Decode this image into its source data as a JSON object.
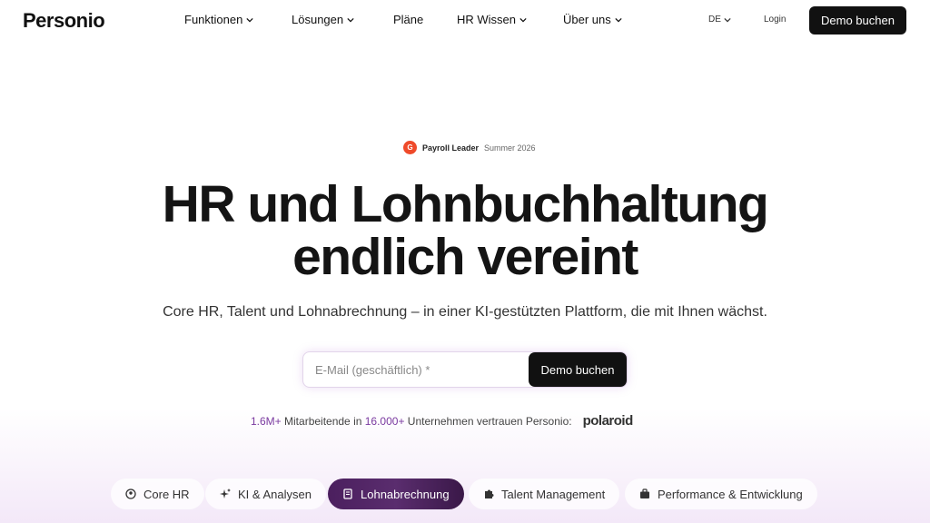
{
  "nav": {
    "logo": "Personio",
    "menu": [
      {
        "label": "Funktionen",
        "dropdown": true
      },
      {
        "label": "Lösungen",
        "dropdown": true
      },
      {
        "label": "Pläne",
        "dropdown": false
      },
      {
        "label": "HR Wissen",
        "dropdown": true
      },
      {
        "label": "Über uns",
        "dropdown": true
      }
    ],
    "lang": "DE",
    "login": "Login",
    "demo": "Demo buchen"
  },
  "badge": {
    "icon": "G",
    "title": "Payroll Leader",
    "subtitle": "Summer 2026"
  },
  "hero": {
    "title_line1": "HR und Lohnbuchhaltung",
    "title_line2": "endlich vereint",
    "subtitle": "Core HR, Talent und Lohnabrechnung – in einer KI-gestützten Plattform, die mit Ihnen wächst.",
    "email_placeholder": "E-Mail (geschäftlich) *",
    "demo_button": "Demo buchen"
  },
  "trust": {
    "count_employees": "1.6M+",
    "text1": " Mitarbeitende in ",
    "count_companies": "16.000+",
    "text2": " Unternehmen vertrauen Personio:",
    "logo": "polaroid"
  },
  "tabs": [
    {
      "label": "Core HR",
      "icon": "user-circle-icon",
      "active": false
    },
    {
      "label": "KI & Analysen",
      "icon": "sparkle-icon",
      "active": false
    },
    {
      "label": "Lohnabrechnung",
      "icon": "receipt-icon",
      "active": true
    },
    {
      "label": "Talent Management",
      "icon": "puzzle-icon",
      "active": false
    },
    {
      "label": "Performance & Entwicklung",
      "icon": "briefcase-icon",
      "active": false
    }
  ],
  "colors": {
    "accent": "#7a3aa0",
    "dark": "#111111",
    "active_tab": "#4b1f5e"
  }
}
